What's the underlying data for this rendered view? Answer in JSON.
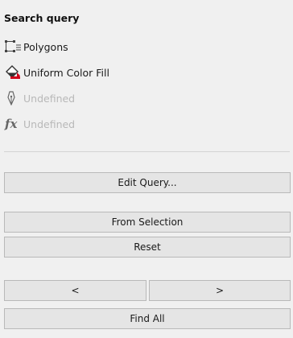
{
  "panel": {
    "title": "Search query"
  },
  "properties": [
    {
      "label": "Polygons",
      "icon": "polygon-select-icon",
      "enabled": true
    },
    {
      "label": "Uniform Color Fill",
      "icon": "fill-bucket-icon",
      "enabled": true
    },
    {
      "label": "Undefined",
      "icon": "pen-nib-icon",
      "enabled": false
    },
    {
      "label": "Undefined",
      "icon": "fx-icon",
      "enabled": false
    }
  ],
  "buttons": {
    "edit_query": "Edit Query...",
    "from_selection": "From Selection",
    "reset": "Reset",
    "prev": "<",
    "next": ">",
    "find_all": "Find All"
  },
  "colors": {
    "fill_icon_red": "#d0021b",
    "disabled_text": "#b8b8b8"
  }
}
